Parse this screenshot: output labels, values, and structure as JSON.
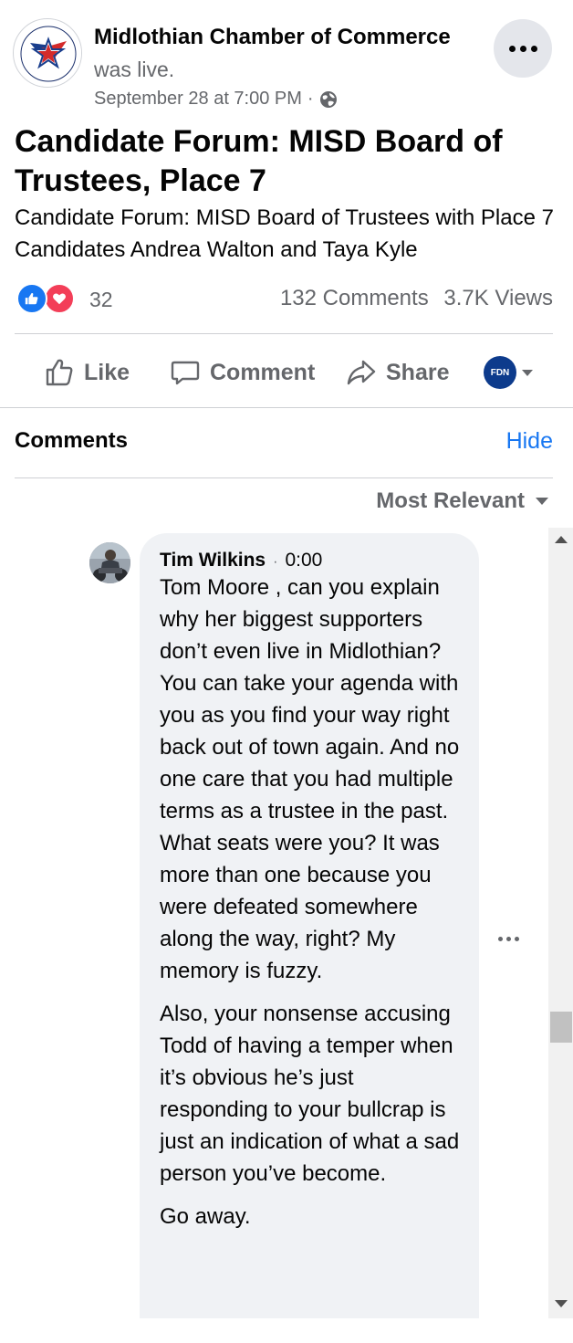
{
  "post": {
    "page_name": "Midlothian Chamber of Commerce",
    "status": "was live.",
    "date": "September 28 at 7:00 PM",
    "date_sep": "·",
    "title": "Candidate Forum: MISD Board of Trustees, Place 7",
    "description": "Candidate Forum: MISD Board of Trustees with Place 7 Candidates Andrea Walton and Taya Kyle",
    "logo_text": {
      "top": "THE CHAMBER",
      "bottom": "MIDLOTHIAN TEXAS · SINCE 1936"
    }
  },
  "stats": {
    "reaction_count": "32",
    "comments": "132 Comments",
    "views": "3.7K Views"
  },
  "actions": {
    "like": "Like",
    "comment": "Comment",
    "share": "Share",
    "profile_badge": "FDN"
  },
  "comments_section": {
    "title": "Comments",
    "hide": "Hide",
    "sort": "Most Relevant"
  },
  "comment": {
    "author": "Tim Wilkins",
    "sep": "·",
    "time": "0:00",
    "paragraphs": [
      "Tom Moore , can you explain why her biggest supporters don’t even live in Midlothian? You can take your agenda with you as you find your way right back out of town again. And no one care that you had multiple terms as a trustee in the past. What seats were you? It was more than one because you were defeated somewhere along the way, right? My memory is fuzzy.",
      "Also, your nonsense accusing Todd of having a temper when it’s obvious he’s just responding to your bullcrap is just an indication of what a sad person you’ve become.",
      "Go away."
    ]
  },
  "colors": {
    "accent": "#1877f2",
    "love": "#f33e58",
    "secondary_text": "#65676b",
    "bubble": "#f0f2f5"
  }
}
